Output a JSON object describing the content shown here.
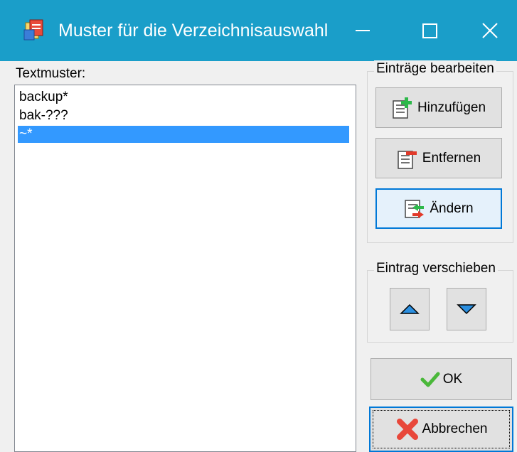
{
  "window": {
    "title": "Muster für die Verzeichnisauswahl",
    "accent_color": "#1a9ec9",
    "app_icon": "folder-app-icon",
    "minimize_icon": "minimize-icon",
    "maximize_icon": "maximize-icon",
    "close_icon": "close-icon"
  },
  "patterns": {
    "label": "Textmuster:",
    "items": [
      "backup*",
      "bak-???",
      "~*"
    ],
    "selected_index": 2,
    "selection_color": "#3399ff"
  },
  "edit_group": {
    "title": "Einträge bearbeiten",
    "add_label": "Hinzufügen",
    "add_icon": "add-entry-icon",
    "remove_label": "Entfernen",
    "remove_icon": "remove-entry-icon",
    "change_label": "Ändern",
    "change_icon": "change-entry-icon"
  },
  "move_group": {
    "title": "Eintrag verschieben",
    "up_icon": "arrow-up-icon",
    "down_icon": "arrow-down-icon"
  },
  "dialog_buttons": {
    "ok_label": "OK",
    "ok_icon": "checkmark-icon",
    "cancel_label": "Abbrechen",
    "cancel_icon": "cross-icon"
  }
}
